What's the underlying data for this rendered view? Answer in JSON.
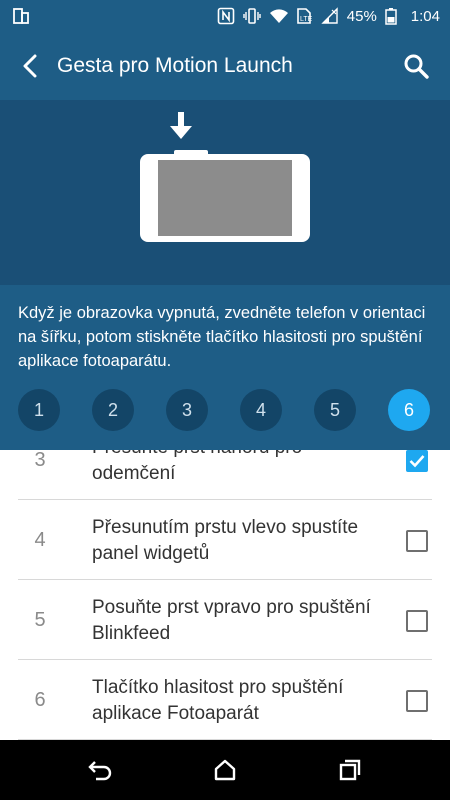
{
  "status_bar": {
    "battery_percent": "45%",
    "time": "1:04",
    "icons": [
      "sim-toolkit-icon",
      "nfc-icon",
      "vibrate-icon",
      "wifi-icon",
      "mobile-data-icon",
      "signal-icon",
      "battery-icon"
    ]
  },
  "app_bar": {
    "title": "Gesta pro Motion Launch",
    "back_icon": "back-arrow-icon",
    "search_icon": "search-icon"
  },
  "illustration": {
    "arrow_icon": "down-arrow-icon",
    "device": "phone-landscape-illustration"
  },
  "description": "Když je obrazovka vypnutá, zvedněte telefon v orientaci na šířku, potom stiskněte tlačítko hlasitosti pro spuštění aplikace fotoaparátu.",
  "steps": [
    {
      "label": "1",
      "active": false
    },
    {
      "label": "2",
      "active": false
    },
    {
      "label": "3",
      "active": false
    },
    {
      "label": "4",
      "active": false
    },
    {
      "label": "5",
      "active": false
    },
    {
      "label": "6",
      "active": true
    }
  ],
  "options": [
    {
      "number": "3",
      "label": "Přesuňte prst nahoru pro odemčení",
      "checked": true
    },
    {
      "number": "4",
      "label": "Přesunutím prstu vlevo spustíte panel widgetů",
      "checked": false
    },
    {
      "number": "5",
      "label": "Posuňte prst vpravo pro spuštění Blinkfeed",
      "checked": false
    },
    {
      "number": "6",
      "label": "Tlačítko hlasitost pro spuštění aplikace Fotoaparát",
      "checked": false
    }
  ],
  "nav_bar": {
    "back_icon": "nav-back-icon",
    "home_icon": "nav-home-icon",
    "recents_icon": "nav-recents-icon"
  },
  "colors": {
    "app_bar": "#1e5d86",
    "hero": "#1a4f76",
    "accent": "#1ea8f0",
    "step_inactive": "#134567"
  }
}
